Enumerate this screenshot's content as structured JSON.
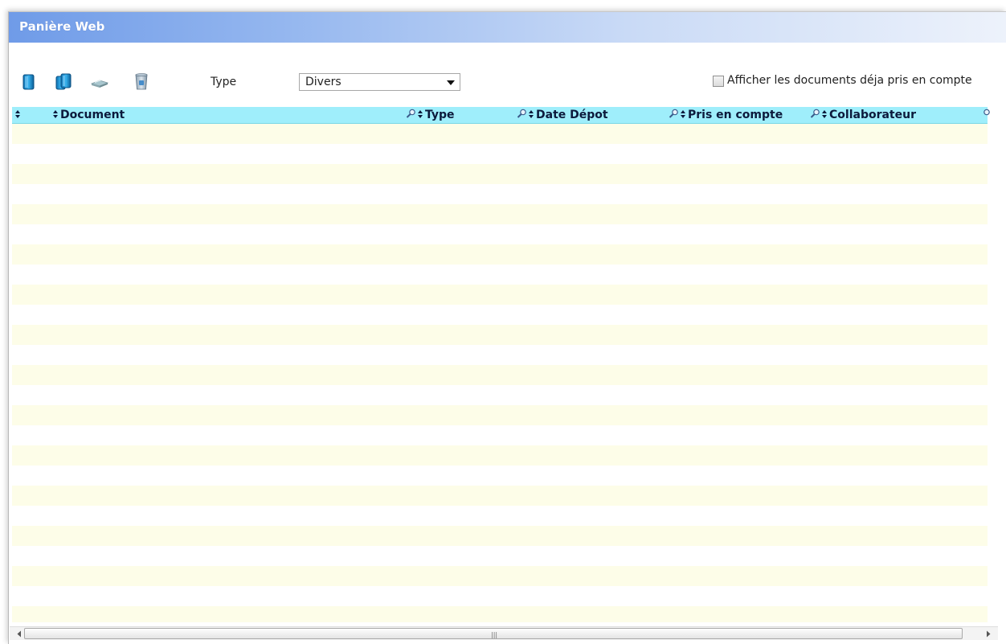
{
  "window": {
    "title": "Panière Web"
  },
  "toolbar": {
    "buttons": [
      {
        "icon": "new-document-icon",
        "tooltip": ""
      },
      {
        "icon": "copy-documents-icon",
        "tooltip": ""
      },
      {
        "icon": "scanner-icon",
        "tooltip": ""
      },
      {
        "icon": "trash-icon",
        "tooltip": ""
      }
    ],
    "type_label": "Type",
    "type_select": {
      "value": "Divers"
    },
    "show_taken_checkbox": {
      "checked": false,
      "label": "Afficher les documents déja pris en compte"
    }
  },
  "grid": {
    "columns": [
      {
        "label": "",
        "sortable": true,
        "filterable": false
      },
      {
        "label": "Document",
        "sortable": true,
        "filterable": true
      },
      {
        "label": "Type",
        "sortable": true,
        "filterable": true
      },
      {
        "label": "Date Dépot",
        "sortable": true,
        "filterable": true
      },
      {
        "label": "Pris en compte",
        "sortable": true,
        "filterable": true
      },
      {
        "label": "Collaborateur",
        "sortable": true,
        "filterable": true
      }
    ],
    "rows": [],
    "colors": {
      "header_bg": "#9feefb",
      "row_alt_bg": "#fdfde8",
      "header_text": "#0c1a3c"
    }
  },
  "colors": {
    "titlebar_start": "#6f9be8",
    "titlebar_end": "#edf2fb"
  }
}
